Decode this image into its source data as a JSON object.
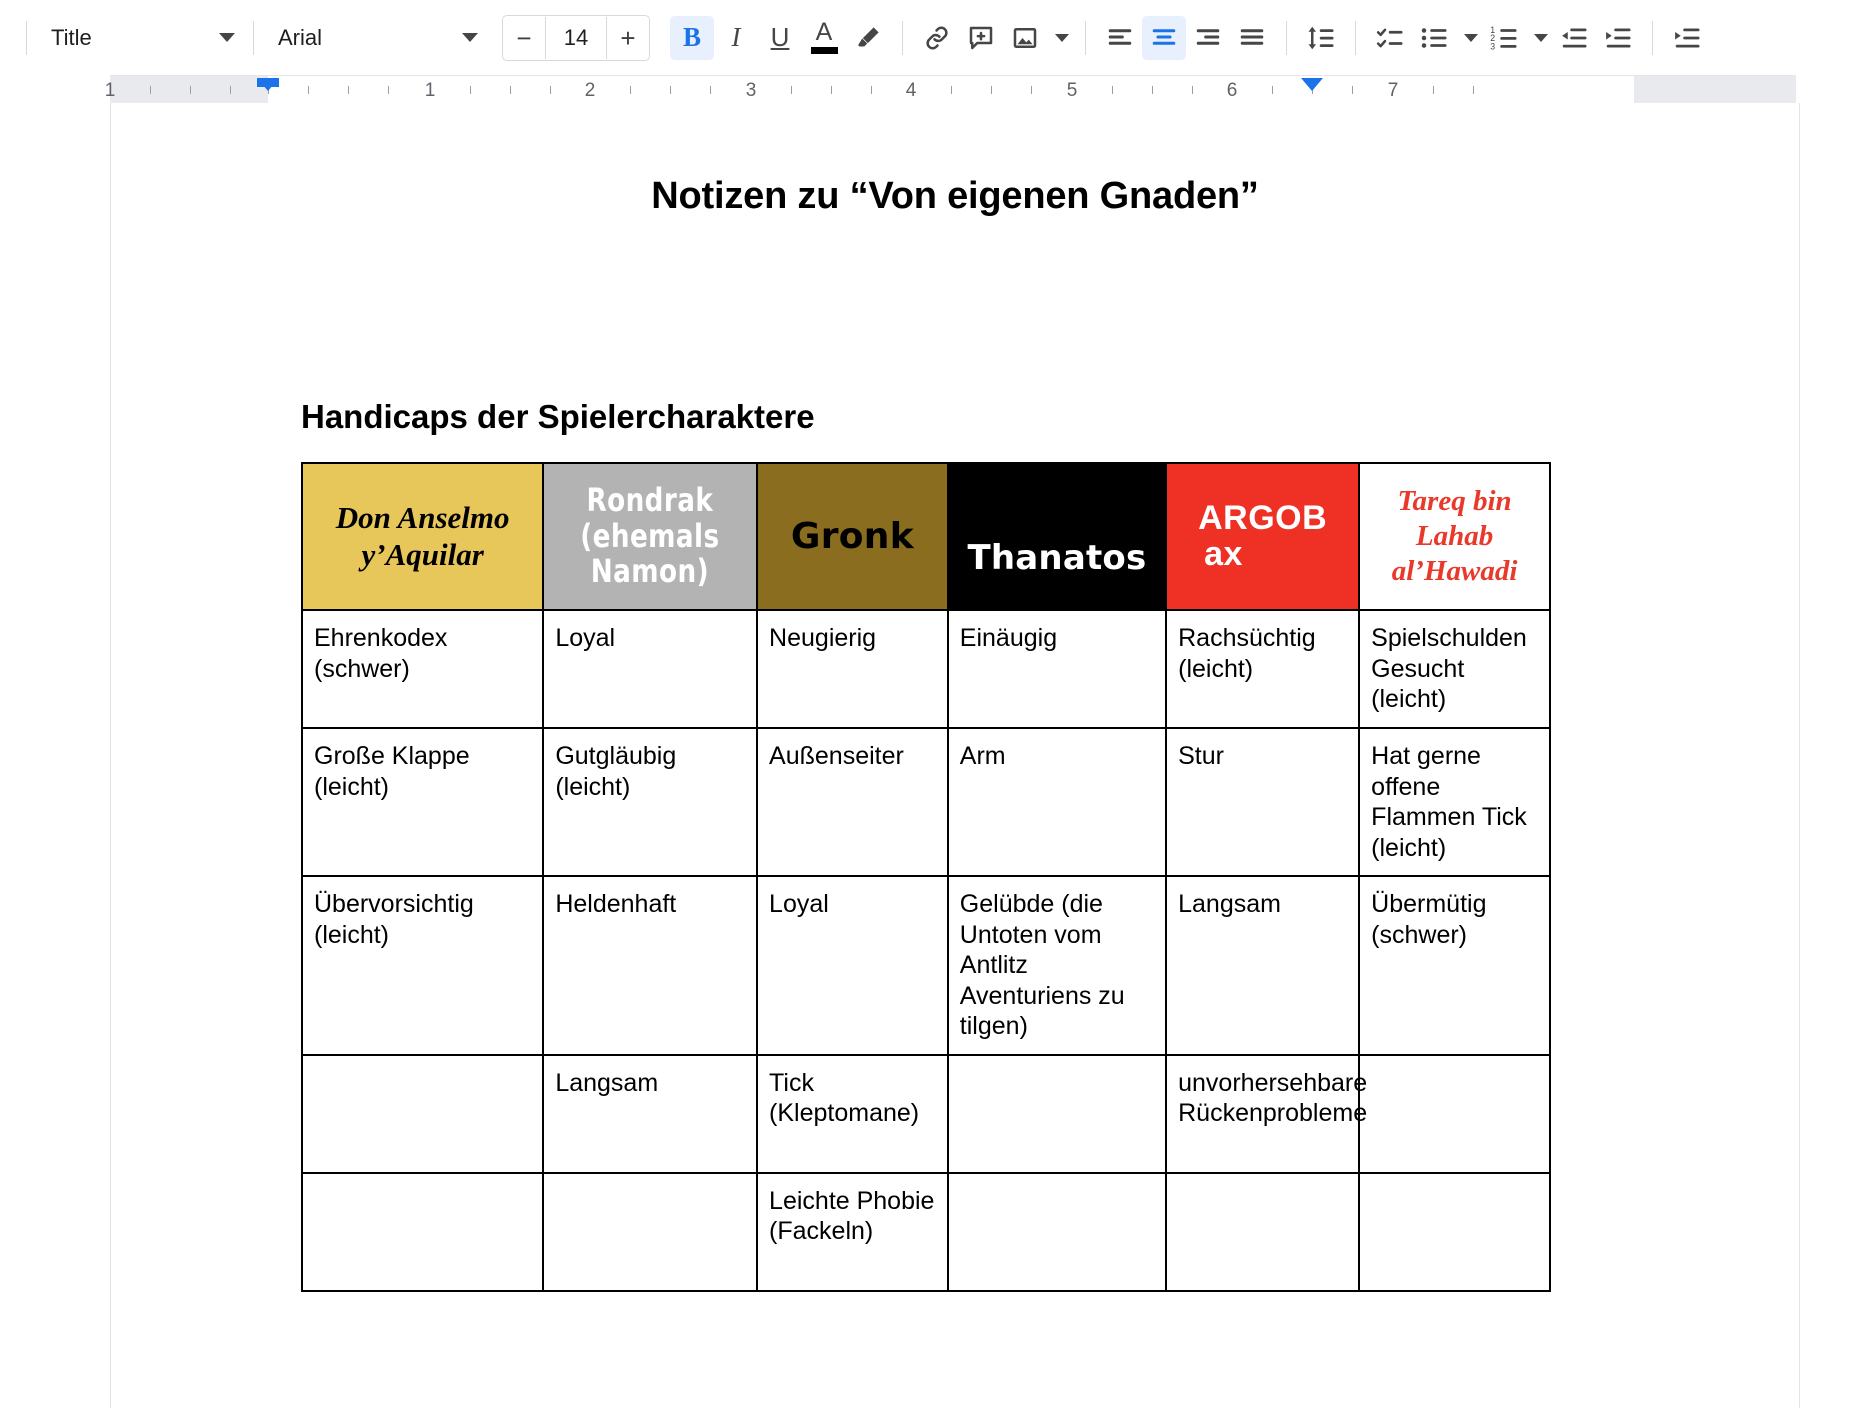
{
  "toolbar": {
    "paragraph_style": "Title",
    "font_family": "Arial",
    "font_size": "14",
    "decrease_font_label": "−",
    "increase_font_label": "+",
    "bold_label": "B",
    "italic_label": "I",
    "underline_label": "U",
    "text_color_label": "A",
    "icons": [
      "bold-icon",
      "italic-icon",
      "underline-icon",
      "text-color-icon",
      "highlight-icon",
      "link-icon",
      "comment-icon",
      "image-icon",
      "align-left-icon",
      "align-center-icon",
      "align-right-icon",
      "align-justify-icon",
      "line-spacing-icon",
      "checklist-icon",
      "bulleted-list-icon",
      "numbered-list-icon",
      "decrease-indent-icon",
      "increase-indent-icon"
    ],
    "active": {
      "bold": true,
      "align_center": true
    },
    "accent_color": "#1a73e8",
    "text_color_swatch": "#000000"
  },
  "ruler": {
    "numbers": [
      "1",
      "1",
      "2",
      "3",
      "4",
      "5",
      "6",
      "7"
    ],
    "left_indent_marker": "left-indent-marker",
    "right_indent_marker": "right-indent-marker"
  },
  "document": {
    "title": "Notizen zu “Von eigenen Gnaden”",
    "section_heading": "Handicaps der Spielercharaktere",
    "table": {
      "headers": [
        {
          "name": "Don Anselmo y’Aquilar",
          "bg": "#e8c75a",
          "fg": "#000000",
          "style": "serif-bold-italic"
        },
        {
          "name": "Rondrak (ehemals Namon)",
          "bg": "#b3b3b3",
          "fg": "#ffffff",
          "style": "condensed-bold"
        },
        {
          "name": "Gronk",
          "bg": "#8a6d1f",
          "fg": "#000000",
          "style": "rounded-bold"
        },
        {
          "name": "Thanatos",
          "bg": "#000000",
          "fg": "#ffffff",
          "style": "rounded-bold"
        },
        {
          "name": "ARGOB ax",
          "bg": "#ee3124",
          "fg": "#ffffff",
          "style": "sans-bold"
        },
        {
          "name": "Tareq bin Lahab al’Hawadi",
          "bg": "#ffffff",
          "fg": "#e8392a",
          "style": "serif-bold-italic"
        }
      ],
      "header_lines": [
        [
          "Don Anselmo",
          "y’Aquilar"
        ],
        [
          "Rondrak",
          "(ehemals",
          "Namon)"
        ],
        [
          "Gronk"
        ],
        [
          "Thanatos"
        ],
        [
          "ARGOB",
          "ax"
        ],
        [
          "Tareq bin",
          "Lahab",
          "al’Hawadi"
        ]
      ],
      "rows": [
        [
          "Ehrenkodex (schwer)",
          "Loyal",
          "Neugierig",
          "Einäugig",
          "Rachsüchtig (leicht)",
          "Spielschulden Gesucht (leicht)"
        ],
        [
          "Große Klappe (leicht)",
          "Gutgläubig (leicht)",
          "Außenseiter",
          "Arm",
          "Stur",
          "Hat gerne offene Flammen  Tick (leicht)"
        ],
        [
          "Übervorsichtig (leicht)",
          "Heldenhaft",
          "Loyal",
          "Gelübde (die Untoten vom Antlitz Aventuriens zu tilgen)",
          "Langsam",
          "Übermütig (schwer)"
        ],
        [
          "",
          "Langsam",
          "Tick (Kleptomane)",
          "",
          "unvorhersehbare Rückenprobleme",
          ""
        ],
        [
          "",
          "",
          "Leichte Phobie (Fackeln)",
          "",
          "",
          ""
        ]
      ]
    }
  }
}
